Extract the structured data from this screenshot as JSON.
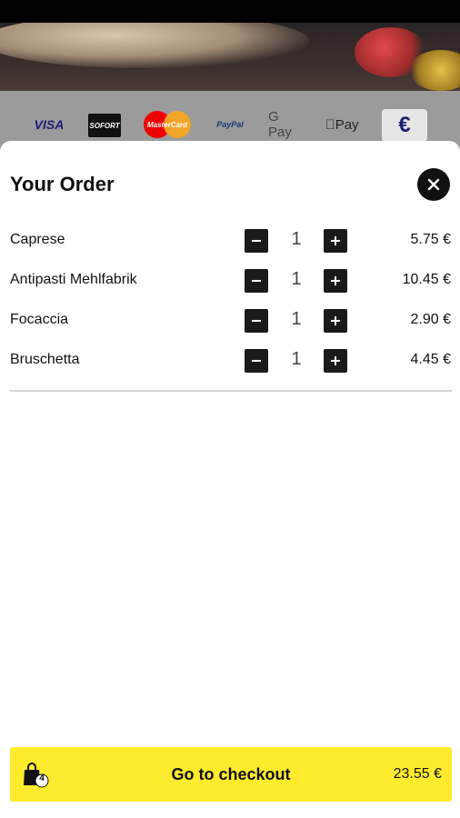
{
  "payments": {
    "visa": "VISA",
    "sofort": "SOFORT",
    "mastercard": "MasterCard",
    "paypal": "PayPal",
    "gpay": "G Pay",
    "applepay": "Pay",
    "euro": "€"
  },
  "order": {
    "title": "Your Order",
    "items": [
      {
        "name": "Caprese",
        "qty": "1",
        "price": "5.75 €"
      },
      {
        "name": "Antipasti Mehlfabrik",
        "qty": "1",
        "price": "10.45 €"
      },
      {
        "name": "Focaccia",
        "qty": "1",
        "price": "2.90 €"
      },
      {
        "name": "Bruschetta",
        "qty": "1",
        "price": "4.45 €"
      }
    ]
  },
  "checkout": {
    "label": "Go to checkout",
    "total": "23.55 €",
    "bag_count": "4"
  },
  "colors": {
    "accent": "#ffeb2e",
    "button_dark": "#1a1a1a"
  }
}
